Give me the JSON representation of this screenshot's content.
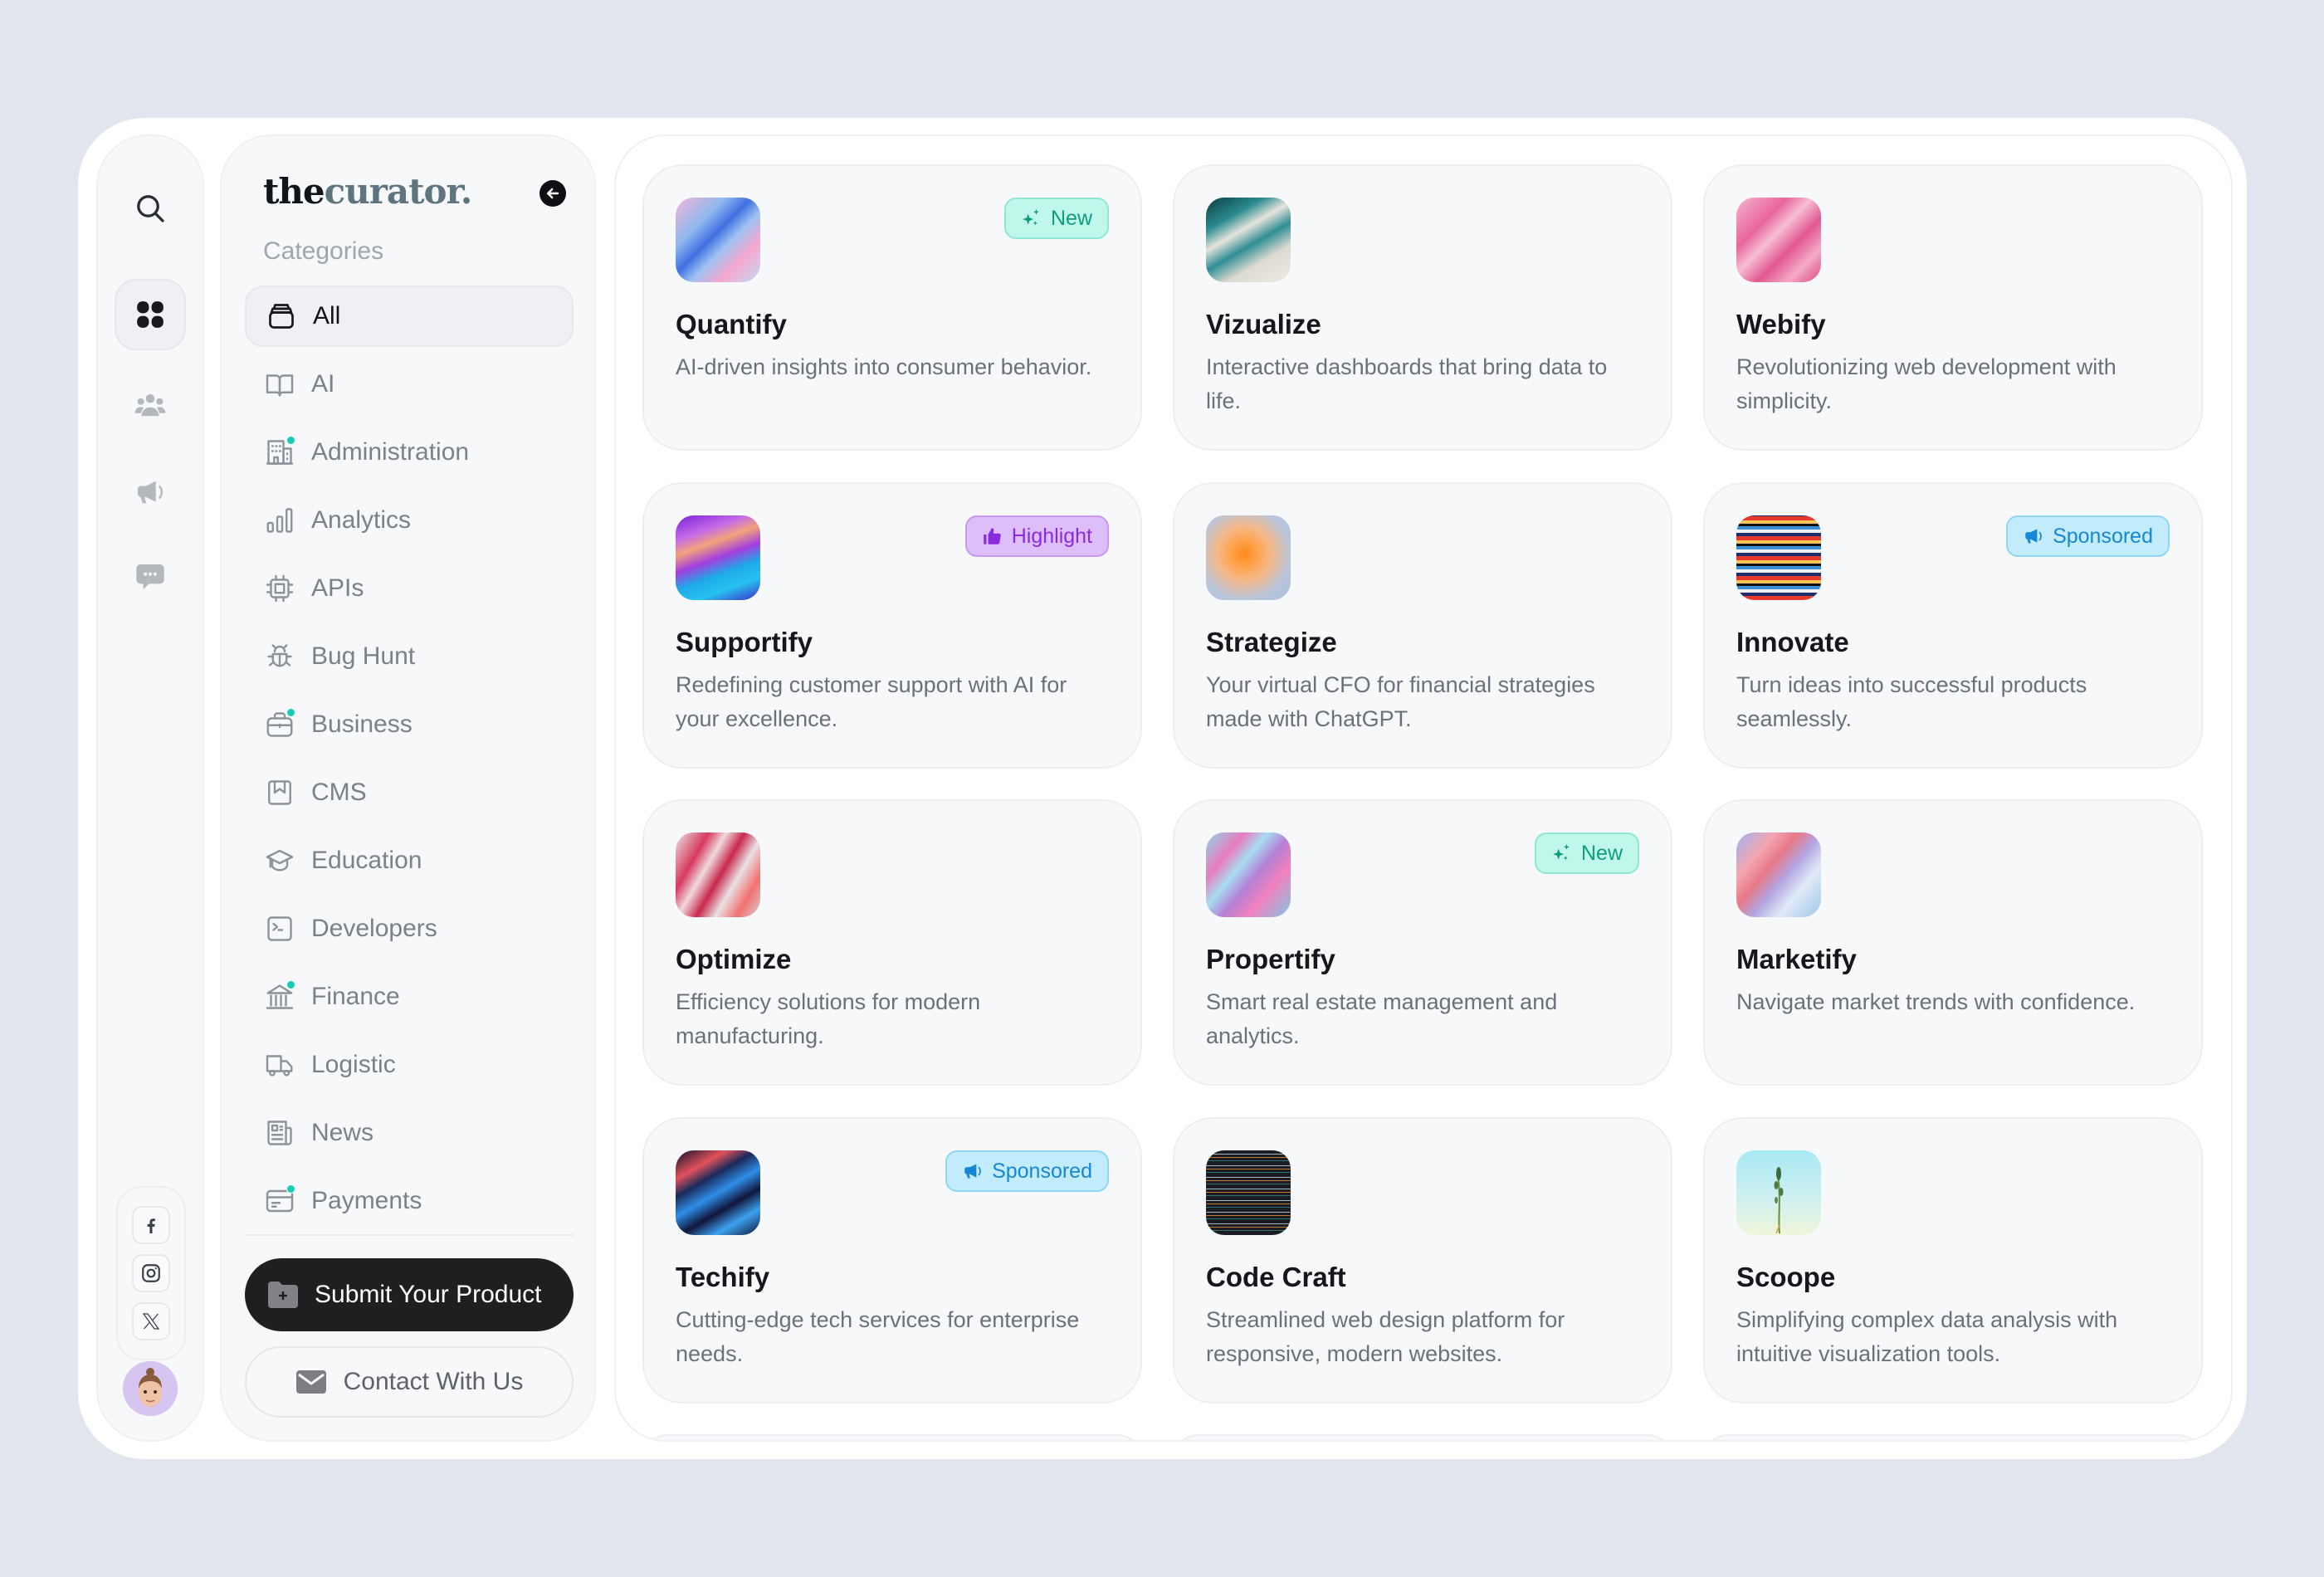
{
  "rail": {
    "items": [
      {
        "icon": "search-icon"
      },
      {
        "icon": "grid-icon",
        "active": true
      },
      {
        "icon": "community-icon"
      },
      {
        "icon": "megaphone-icon"
      },
      {
        "icon": "chat-icon"
      }
    ],
    "socials": [
      {
        "icon": "facebook-icon"
      },
      {
        "icon": "instagram-icon"
      },
      {
        "icon": "x-twitter-icon"
      }
    ],
    "avatar": "user-avatar"
  },
  "sidebar": {
    "logo_the": "the",
    "logo_curator": "curator.",
    "categories_title": "Categories",
    "items": [
      {
        "label": "All",
        "icon": "inbox-stack-icon",
        "active": true,
        "dot": false
      },
      {
        "label": "AI",
        "icon": "book-open-icon",
        "dot": false
      },
      {
        "label": "Administration",
        "icon": "building-icon",
        "dot": true
      },
      {
        "label": "Analytics",
        "icon": "bar-chart-icon",
        "dot": false
      },
      {
        "label": "APIs",
        "icon": "chip-icon",
        "dot": false
      },
      {
        "label": "Bug Hunt",
        "icon": "bug-icon",
        "dot": false
      },
      {
        "label": "Business",
        "icon": "briefcase-icon",
        "dot": true
      },
      {
        "label": "CMS",
        "icon": "bookmark-icon",
        "dot": false
      },
      {
        "label": "Education",
        "icon": "graduation-cap-icon",
        "dot": false
      },
      {
        "label": "Developers",
        "icon": "terminal-icon",
        "dot": false
      },
      {
        "label": "Finance",
        "icon": "bank-icon",
        "dot": true
      },
      {
        "label": "Logistic",
        "icon": "truck-icon",
        "dot": false
      },
      {
        "label": "News",
        "icon": "newspaper-icon",
        "dot": false
      },
      {
        "label": "Payments",
        "icon": "credit-card-icon",
        "dot": true
      }
    ],
    "submit_label": "Submit Your Product",
    "contact_label": "Contact With Us"
  },
  "products": [
    {
      "name": "Quantify",
      "desc": "AI-driven insights into consumer behavior.",
      "badge": "New",
      "badge_type": "new"
    },
    {
      "name": "Vizualize",
      "desc": "Interactive dashboards that bring data to life.",
      "badge": null,
      "badge_type": null
    },
    {
      "name": "Webify",
      "desc": "Revolutionizing web development with simplicity.",
      "badge": null,
      "badge_type": null
    },
    {
      "name": "Supportify",
      "desc": "Redefining customer support with AI for your excellence.",
      "badge": "Highlight",
      "badge_type": "highlight"
    },
    {
      "name": "Strategize",
      "desc": "Your virtual CFO for financial strategies made with ChatGPT.",
      "badge": null,
      "badge_type": null
    },
    {
      "name": "Innovate",
      "desc": "Turn ideas into successful products seamlessly.",
      "badge": "Sponsored",
      "badge_type": "sponsored"
    },
    {
      "name": "Optimize",
      "desc": "Efficiency solutions for modern manufacturing.",
      "badge": null,
      "badge_type": null
    },
    {
      "name": "Propertify",
      "desc": "Smart real estate management and analytics.",
      "badge": "New",
      "badge_type": "new"
    },
    {
      "name": "Marketify",
      "desc": "Navigate market trends with confidence.",
      "badge": null,
      "badge_type": null
    },
    {
      "name": "Techify",
      "desc": "Cutting-edge tech services for enterprise needs.",
      "badge": "Sponsored",
      "badge_type": "sponsored"
    },
    {
      "name": "Code Craft",
      "desc": "Streamlined web design platform for responsive, modern websites.",
      "badge": null,
      "badge_type": null
    },
    {
      "name": "Scoope",
      "desc": "Simplifying complex data analysis with intuitive visualization tools.",
      "badge": null,
      "badge_type": null
    }
  ],
  "colors": {
    "background": "#E1E5EE",
    "accent_dot": "#14CDB8",
    "badge_new": "#109C7E",
    "badge_highlight": "#8B2BE0",
    "badge_sponsored": "#1587D3",
    "primary_button": "#1E1F21"
  }
}
